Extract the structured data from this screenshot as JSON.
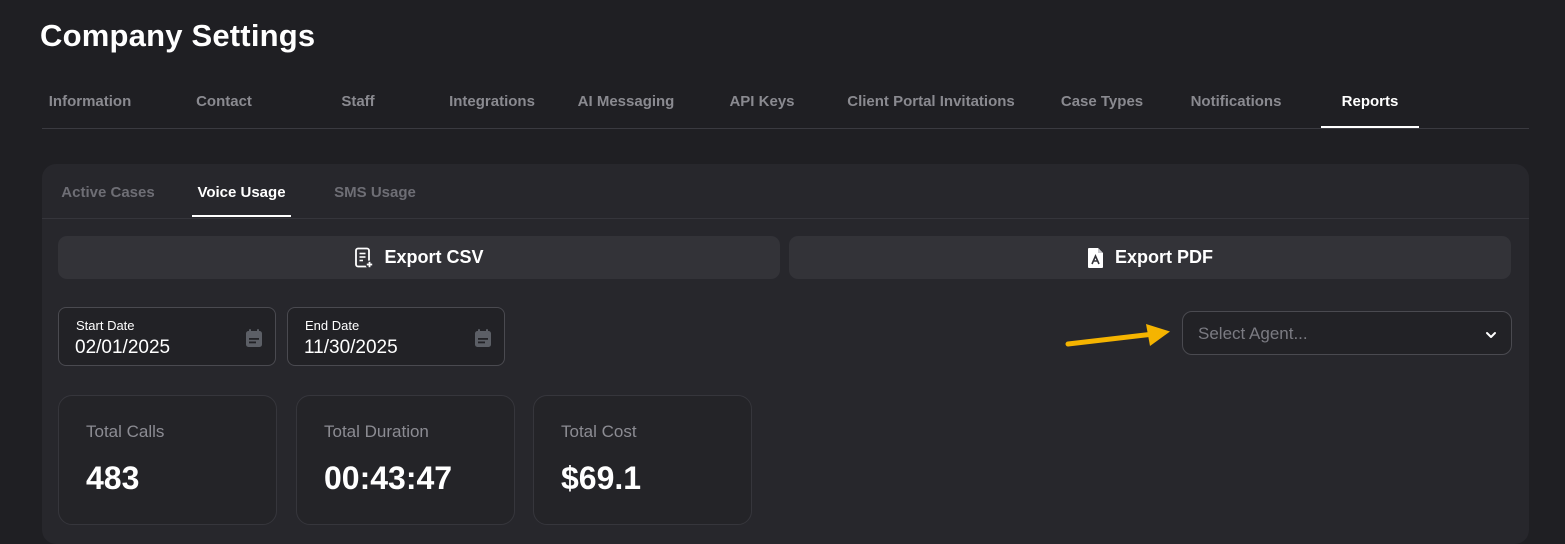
{
  "page": {
    "title": "Company Settings"
  },
  "main_tabs": [
    {
      "label": "Information",
      "active": false
    },
    {
      "label": "Contact",
      "active": false
    },
    {
      "label": "Staff",
      "active": false
    },
    {
      "label": "Integrations",
      "active": false
    },
    {
      "label": "AI Messaging",
      "active": false
    },
    {
      "label": "API Keys",
      "active": false
    },
    {
      "label": "Client Portal Invitations",
      "active": false
    },
    {
      "label": "Case Types",
      "active": false
    },
    {
      "label": "Notifications",
      "active": false
    },
    {
      "label": "Reports",
      "active": true
    }
  ],
  "sub_tabs": [
    {
      "label": "Active Cases",
      "active": false
    },
    {
      "label": "Voice Usage",
      "active": true
    },
    {
      "label": "SMS Usage",
      "active": false
    }
  ],
  "export": {
    "csv_label": "Export CSV",
    "csv_icon": "csv-file-icon",
    "pdf_label": "Export PDF",
    "pdf_icon": "pdf-file-icon"
  },
  "filters": {
    "start_date": {
      "label": "Start Date",
      "value": "02/01/2025",
      "icon": "calendar-icon"
    },
    "end_date": {
      "label": "End Date",
      "value": "11/30/2025",
      "icon": "calendar-icon"
    },
    "agent": {
      "placeholder": "Select Agent...",
      "icon": "chevron-down-icon"
    }
  },
  "annotation": {
    "icon": "arrow-icon",
    "color": "#f5b400"
  },
  "stats": [
    {
      "label": "Total Calls",
      "value": "483"
    },
    {
      "label": "Total Duration",
      "value": "00:43:47"
    },
    {
      "label": "Total Cost",
      "value": "$69.1"
    }
  ],
  "colors": {
    "background": "#1f1f23",
    "panel": "#27272c",
    "button": "#333338",
    "text_primary": "#ffffff",
    "text_muted": "#8a8a90"
  }
}
